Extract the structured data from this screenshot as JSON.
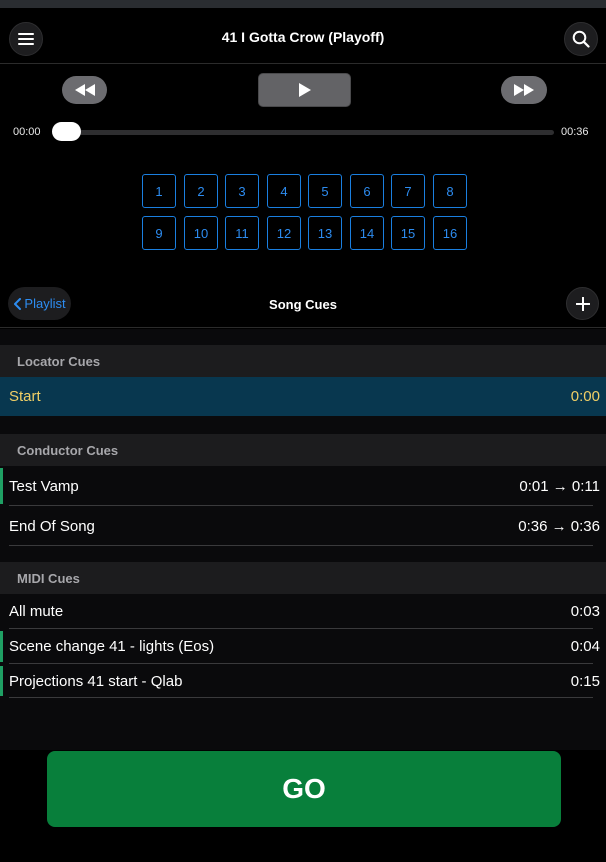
{
  "header": {
    "title": "41 I Gotta Crow (Playoff)",
    "menu_icon": "hamburger-menu-icon",
    "search_icon": "search-icon"
  },
  "transport": {
    "rewind_icon": "rewind-icon",
    "play_icon": "play-icon",
    "forward_icon": "fast-forward-icon",
    "time_start": "00:00",
    "time_end": "00:36",
    "progress": 0
  },
  "number_buttons": [
    "1",
    "2",
    "3",
    "4",
    "5",
    "6",
    "7",
    "8",
    "9",
    "10",
    "11",
    "12",
    "13",
    "14",
    "15",
    "16"
  ],
  "subheader": {
    "back_label": "Playlist",
    "title": "Song Cues",
    "add_icon": "plus-icon"
  },
  "sections": {
    "locator": {
      "title": "Locator Cues",
      "items": [
        {
          "label": "Start",
          "value": "0:00"
        }
      ]
    },
    "conductor": {
      "title": "Conductor Cues",
      "items": [
        {
          "label": "Test Vamp",
          "value": "0:01 → 0:11"
        },
        {
          "label": "End Of Song",
          "value": "0:36 → 0:36"
        }
      ]
    },
    "midi": {
      "title": "MIDI Cues",
      "items": [
        {
          "label": "All mute",
          "value": "0:03"
        },
        {
          "label": "Scene change 41 - lights (Eos)",
          "value": "0:04"
        },
        {
          "label": "Projections 41 start - Qlab",
          "value": "0:15"
        }
      ]
    }
  },
  "go": {
    "label": "GO"
  },
  "colors": {
    "accent_blue": "#2d8cf0",
    "go_green": "#087f3b",
    "selected_row": "#08374f",
    "selected_text": "#f0cf66",
    "marker_green": "#1fa064"
  }
}
